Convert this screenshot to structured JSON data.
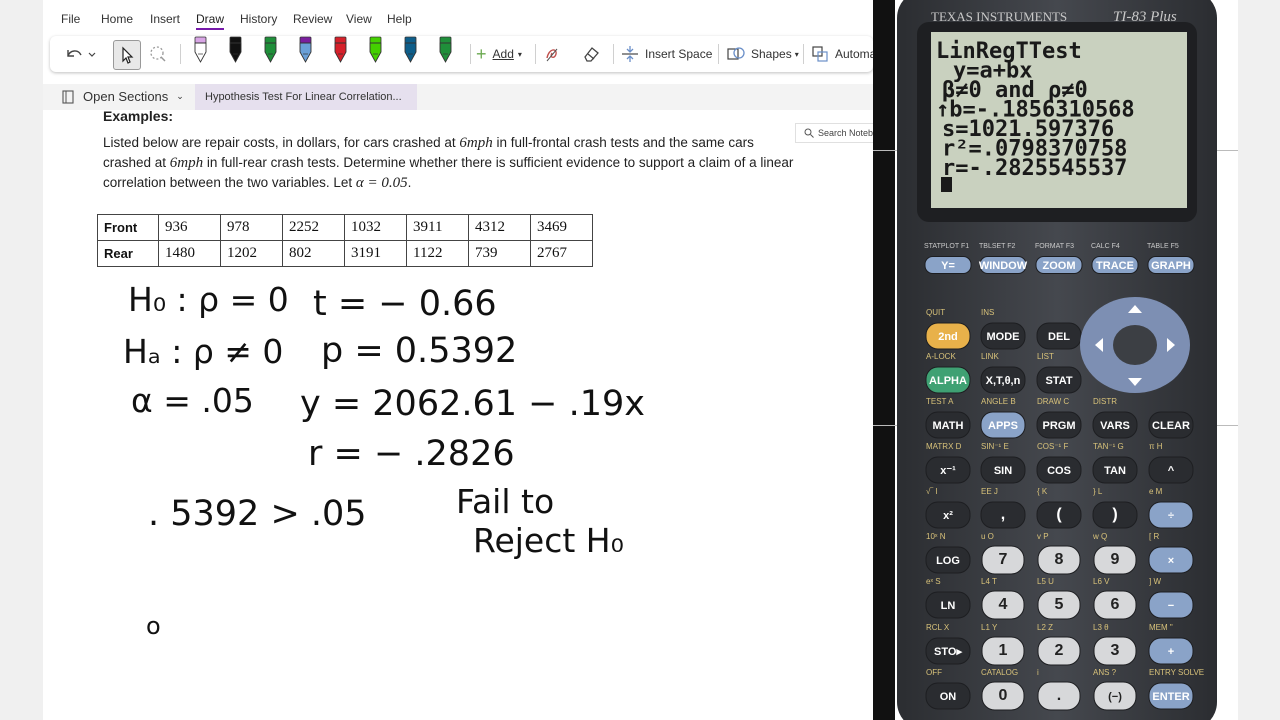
{
  "menu": [
    "File",
    "Home",
    "Insert",
    "Draw",
    "History",
    "Review",
    "View",
    "Help"
  ],
  "menu_active": "Draw",
  "toolbar": {
    "add_label": "Add",
    "insert_space_label": "Insert Space",
    "shapes_label": "Shapes",
    "automate_label": "Automa"
  },
  "pens": [
    {
      "cap": "#d9a6e6",
      "body": "#ffffff"
    },
    {
      "cap": "#111111",
      "body": "#111111"
    },
    {
      "cap": "#1f8f3a",
      "body": "#1f8f3a"
    },
    {
      "cap": "#7a1e9e",
      "body": "#6aa0d8"
    },
    {
      "cap": "#d6202a",
      "body": "#d6202a"
    },
    {
      "cap": "#44d100",
      "body": "#44d100"
    },
    {
      "cap": "#0e5e8a",
      "body": "#0e5e8a"
    },
    {
      "cap": "#1f8f3a",
      "body": "#1f8f3a"
    }
  ],
  "sections": {
    "open_sections": "Open Sections",
    "page_tab": "Hypothesis Test For Linear Correlation..."
  },
  "search_placeholder": "Search Noteb",
  "content": {
    "heading": "Examples:",
    "para1": "Listed below are repair costs, in dollars, for cars crashed at ",
    "speed": "6mph",
    "para2": " in full-frontal crash tests and the same cars crashed at ",
    "para3": " in full-rear crash tests. Determine whether there is sufficient evidence to support a claim of a linear correlation between the two variables. Let ",
    "alpha_expr": "α = 0.05",
    "para_end": "."
  },
  "table": {
    "rows": [
      {
        "label": "Front",
        "values": [
          "936",
          "978",
          "2252",
          "1032",
          "3911",
          "4312",
          "3469"
        ]
      },
      {
        "label": "Rear",
        "values": [
          "1480",
          "1202",
          "802",
          "3191",
          "1122",
          "739",
          "2767"
        ]
      }
    ]
  },
  "handwriting": {
    "h0": "H₀ : ρ = 0",
    "ha": "Hₐ : ρ ≠ 0",
    "alpha": "α = .05",
    "t": "t = − 0.66",
    "p": "p = 0.5392",
    "y": "y = 2062.61 − .19x",
    "r": "r = − .2826",
    "compare": ". 5392 > .05",
    "fail": "Fail  to",
    "reject": "Reject  H₀",
    "circle": "o"
  },
  "calculator": {
    "brand": "TEXAS INSTRUMENTS",
    "model": "TI-83 Plus",
    "screen": [
      "LinRegTTest",
      "y=a+bx",
      "β≠0 and ρ≠0",
      "↑b=-.1856310568",
      "s=1021.597376",
      "r²=.0798370758",
      "r=-.2825545537"
    ],
    "func_labels": [
      "STATPLOT F1",
      "TBLSET F2",
      "FORMAT F3",
      "CALC F4",
      "TABLE F5"
    ],
    "func_keys": [
      "Y=",
      "WINDOW",
      "ZOOM",
      "TRACE",
      "GRAPH"
    ],
    "rows": [
      {
        "top": [
          "QUIT",
          "INS"
        ],
        "keys": [
          "2nd",
          "MODE",
          "DEL"
        ]
      },
      {
        "top": [
          "A-LOCK",
          "LINK",
          "LIST"
        ],
        "keys": [
          "ALPHA",
          "X,T,θ,n",
          "STAT"
        ]
      },
      {
        "top": [
          "TEST  A",
          "ANGLE  B",
          "DRAW  C",
          "DISTR"
        ],
        "keys": [
          "MATH",
          "APPS",
          "PRGM",
          "VARS",
          "CLEAR"
        ]
      },
      {
        "top": [
          "MATRX  D",
          "SIN⁻¹  E",
          "COS⁻¹  F",
          "TAN⁻¹  G",
          "π  H"
        ],
        "keys": [
          "x⁻¹",
          "SIN",
          "COS",
          "TAN",
          "^"
        ]
      },
      {
        "top": [
          "√‾  I",
          "EE  J",
          "{  K",
          "}  L",
          "e  M"
        ],
        "keys": [
          "x²",
          ",",
          "(",
          ")",
          "÷"
        ]
      },
      {
        "top": [
          "10ˣ  N",
          "u  O",
          "v  P",
          "w  Q",
          "[  R"
        ],
        "keys": [
          "LOG",
          "7",
          "8",
          "9",
          "×"
        ]
      },
      {
        "top": [
          "eˣ  S",
          "L4  T",
          "L5  U",
          "L6  V",
          "]  W"
        ],
        "keys": [
          "LN",
          "4",
          "5",
          "6",
          "−"
        ]
      },
      {
        "top": [
          "RCL  X",
          "L1  Y",
          "L2  Z",
          "L3  θ",
          "MEM  \""
        ],
        "keys": [
          "STO▸",
          "1",
          "2",
          "3",
          "+"
        ]
      },
      {
        "top": [
          "OFF",
          "CATALOG",
          "i",
          "ANS  ?",
          "ENTRY SOLVE"
        ],
        "keys": [
          "ON",
          "0",
          ".",
          "(−)",
          "ENTER"
        ]
      }
    ]
  },
  "colors": {
    "accent": "#7719aa",
    "calc_body": "#3c3f44",
    "screen": "#c9d1bf",
    "second_key": "#e8b14a",
    "alpha_key": "#3fa173",
    "blue_key": "#8aa3c8"
  }
}
